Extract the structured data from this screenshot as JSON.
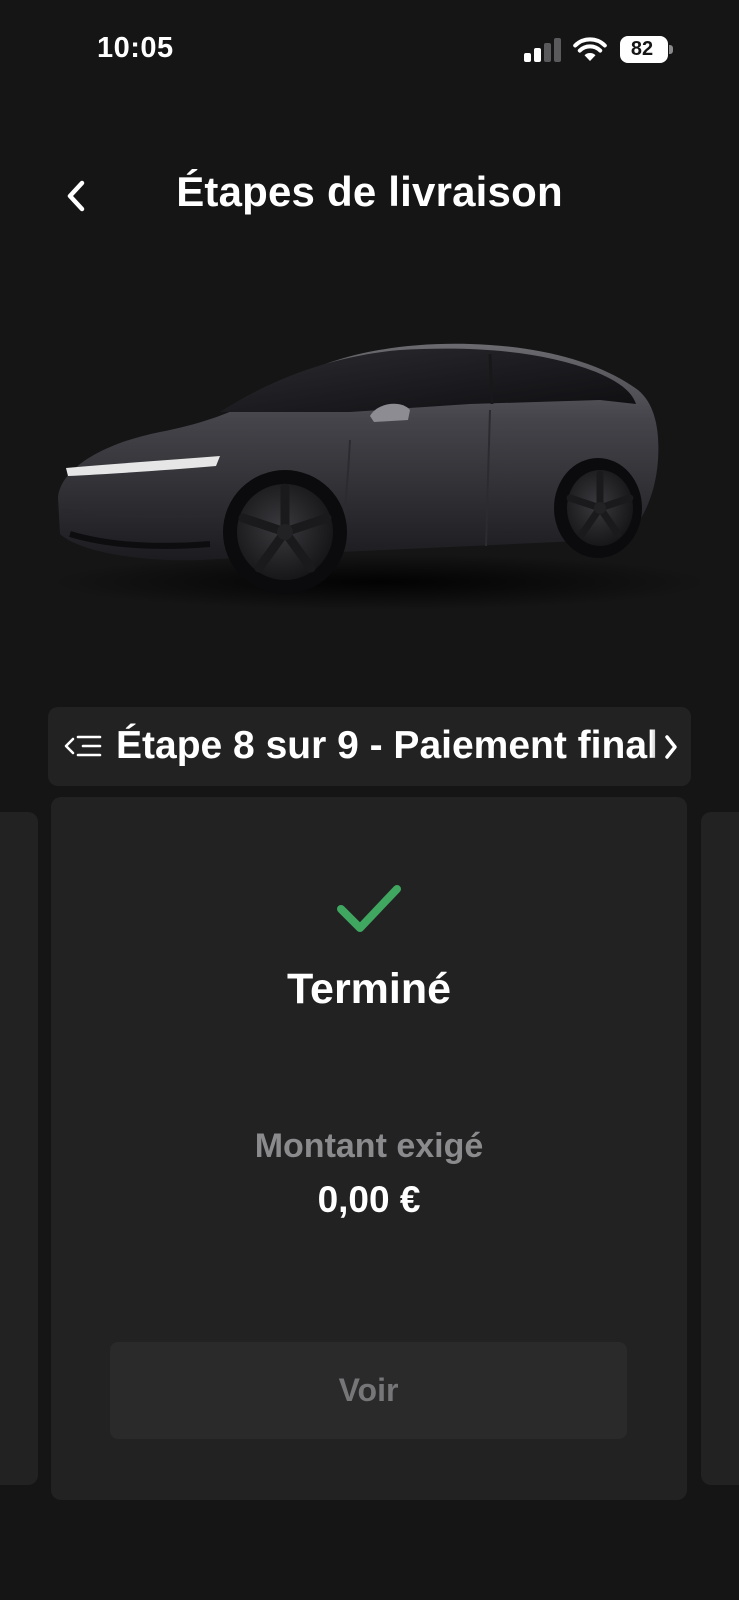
{
  "status_bar": {
    "time": "10:05",
    "battery": "82"
  },
  "header": {
    "title": "Étapes de livraison",
    "back_icon": "chevron-left-icon"
  },
  "step_selector": {
    "label": "Étape 8 sur 9 - Paiement final",
    "list_icon": "list-icon",
    "next_icon": "chevron-right-icon"
  },
  "step_card": {
    "status_icon": "checkmark-icon",
    "status": "Terminé",
    "amount_label": "Montant exigé",
    "amount_value": "0,00 €",
    "button_label": "Voir"
  },
  "colors": {
    "background": "#151516",
    "card": "#222223",
    "success": "#3fa760",
    "muted_text": "#8b8b8d"
  }
}
